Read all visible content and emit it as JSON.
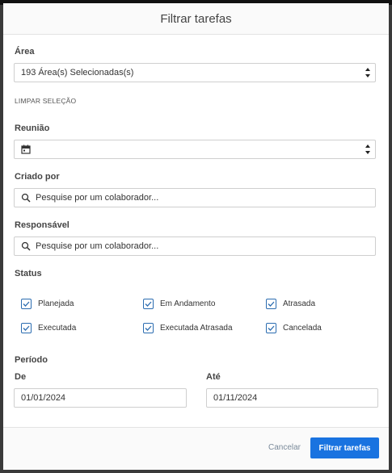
{
  "modal": {
    "title": "Filtrar tarefas"
  },
  "area": {
    "label": "Área",
    "selected": "193 Área(s) Selecionadas(s)",
    "clear_label": "LIMPAR SELEÇÃO"
  },
  "reuniao": {
    "label": "Reunião",
    "icon": "calendar-icon",
    "value": ""
  },
  "criado_por": {
    "label": "Criado por",
    "placeholder": "Pesquise por um colaborador...",
    "icon": "search-icon"
  },
  "responsavel": {
    "label": "Responsável",
    "placeholder": "Pesquise por um colaborador...",
    "icon": "search-icon"
  },
  "status": {
    "label": "Status",
    "options": [
      {
        "label": "Planejada",
        "checked": true
      },
      {
        "label": "Em Andamento",
        "checked": true
      },
      {
        "label": "Atrasada",
        "checked": true
      },
      {
        "label": "Executada",
        "checked": true
      },
      {
        "label": "Executada Atrasada",
        "checked": true
      },
      {
        "label": "Cancelada",
        "checked": true
      }
    ]
  },
  "periodo": {
    "label": "Período",
    "from_label": "De",
    "from_value": "01/01/2024",
    "to_label": "Até",
    "to_value": "01/11/2024"
  },
  "footer": {
    "cancel_label": "Cancelar",
    "submit_label": "Filtrar tarefas"
  },
  "colors": {
    "primary": "#1973e0",
    "checkbox": "#2b6cb0"
  }
}
